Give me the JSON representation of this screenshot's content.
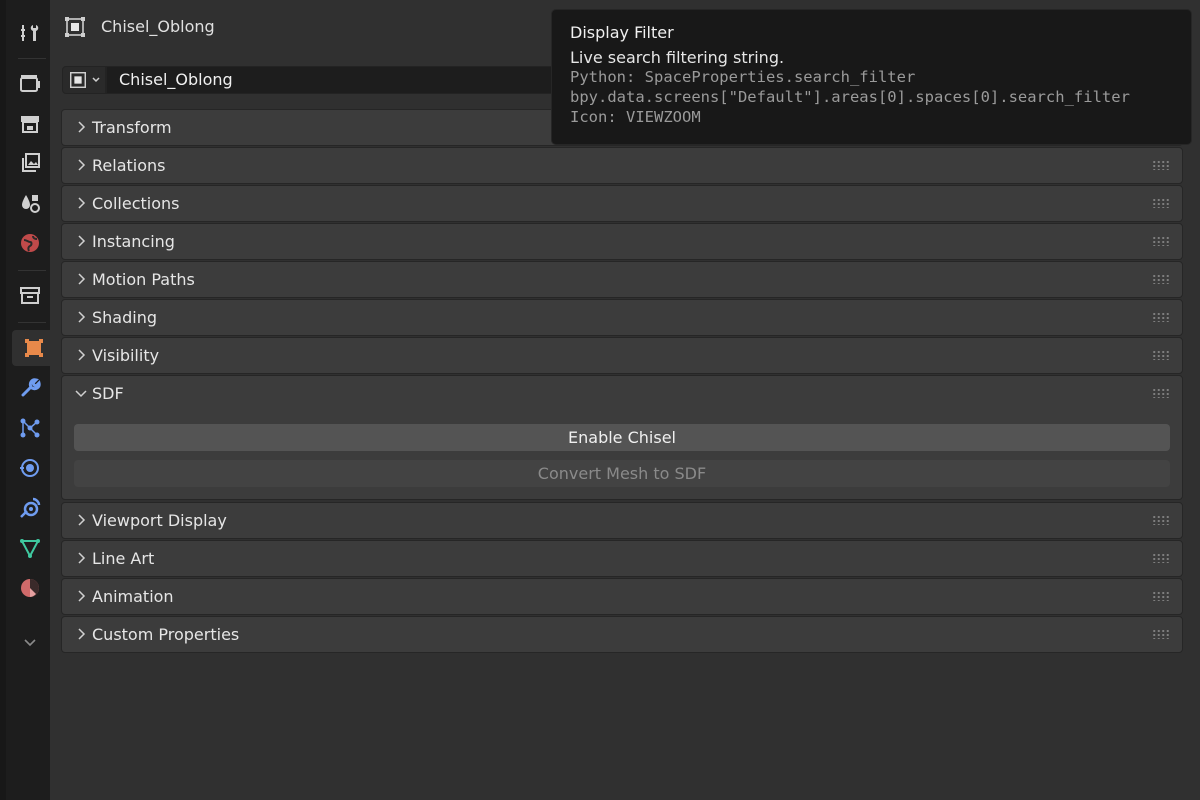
{
  "header": {
    "title": "Chisel_Oblong"
  },
  "object_name": {
    "value": "Chisel_Oblong"
  },
  "sidebar": {
    "tabs": [
      {
        "name": "tool-icon",
        "active": false
      },
      {
        "name": "render-icon",
        "active": false
      },
      {
        "name": "output-icon",
        "active": false
      },
      {
        "name": "view-layer-icon",
        "active": false
      },
      {
        "name": "scene-icon",
        "active": false
      },
      {
        "name": "world-icon",
        "active": false
      },
      {
        "name": "collection-icon",
        "active": false
      },
      {
        "name": "object-icon",
        "active": true
      },
      {
        "name": "modifier-icon",
        "active": false
      },
      {
        "name": "particles-icon",
        "active": false
      },
      {
        "name": "physics-icon",
        "active": false
      },
      {
        "name": "constraints-icon",
        "active": false
      },
      {
        "name": "data-icon",
        "active": false
      },
      {
        "name": "material-icon",
        "active": false
      },
      {
        "name": "expand-icon",
        "active": false
      }
    ]
  },
  "panels": {
    "transform": "Transform",
    "relations": "Relations",
    "collections": "Collections",
    "instancing": "Instancing",
    "motion_paths": "Motion Paths",
    "shading": "Shading",
    "visibility": "Visibility",
    "sdf": "SDF",
    "viewport_display": "Viewport Display",
    "line_art": "Line Art",
    "animation": "Animation",
    "custom_properties": "Custom Properties"
  },
  "sdf": {
    "enable_label": "Enable Chisel",
    "convert_label": "Convert Mesh to SDF"
  },
  "tooltip": {
    "title": "Display Filter",
    "description": "Live search filtering string.",
    "python": "Python: SpaceProperties.search_filter",
    "path": "bpy.data.screens[\"Default\"].areas[0].spaces[0].search_filter",
    "icon": "Icon: VIEWZOOM"
  },
  "colors": {
    "background": "#303030",
    "panel": "#3c3c3c",
    "sidebar": "#1d1d1d",
    "object_orange": "#e8894a",
    "modifier_blue": "#6f9cf0",
    "data_green": "#3fc9a0",
    "material_red": "#d06a6a"
  }
}
